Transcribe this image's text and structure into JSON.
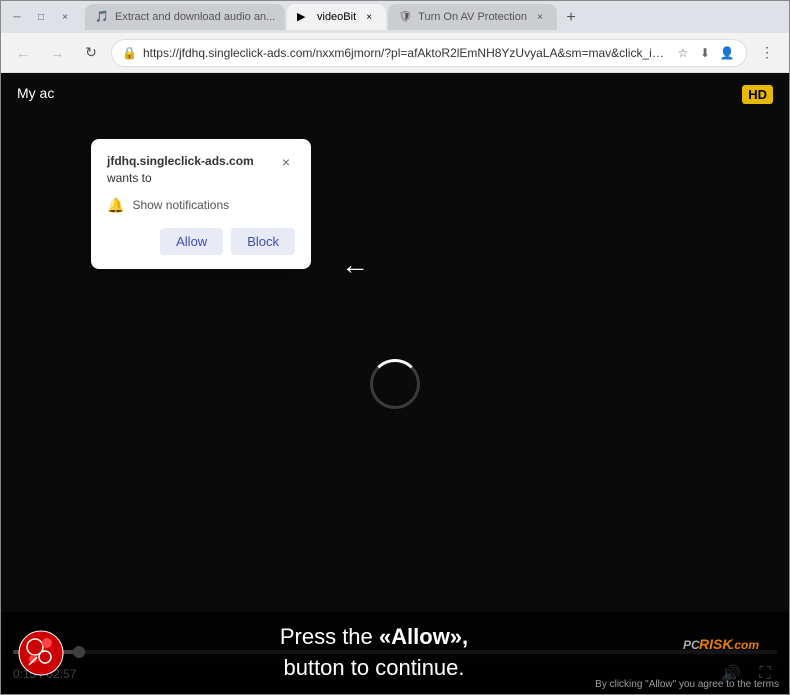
{
  "browser": {
    "tabs": [
      {
        "id": "tab1",
        "label": "Extract and download audio an...",
        "favicon": "🎵",
        "active": false
      },
      {
        "id": "tab2",
        "label": "videoBit",
        "favicon": "▶",
        "active": true
      },
      {
        "id": "tab3",
        "label": "Turn On AV Protection",
        "favicon": "🛡",
        "active": false
      }
    ],
    "new_tab_label": "+",
    "address_bar": {
      "url": "https://jfdhq.singleclick-ads.com/nxxm6jmorn/?pl=afAktoR2lEmNH8YzUvyaLA&sm=mav&click_id=2ade34eb74fc6d6fbd324f89...",
      "secure_icon": "🔒"
    },
    "nav_buttons": {
      "back": "←",
      "forward": "→",
      "refresh": "↻"
    }
  },
  "notification_popup": {
    "domain": "jfdhq.singleclick-ads.com",
    "wants_to": "wants to",
    "description": "Show notifications",
    "allow_label": "Allow",
    "block_label": "Block",
    "close_label": "×"
  },
  "video_player": {
    "title_overlay": "My ac",
    "hd_badge": "HD",
    "time_current": "0:15",
    "time_total": "02:57",
    "progress_percent": 8.6
  },
  "bottom_overlay": {
    "press_text_line1": "Press the",
    "allow_bold": "«Allow»,",
    "press_text_line2": "button to continue.",
    "pcrisk_brand": "RISK.com",
    "bottom_notice": "By clicking \"Allow\" you agree to the terms"
  },
  "arrow": {
    "symbol": "←"
  }
}
